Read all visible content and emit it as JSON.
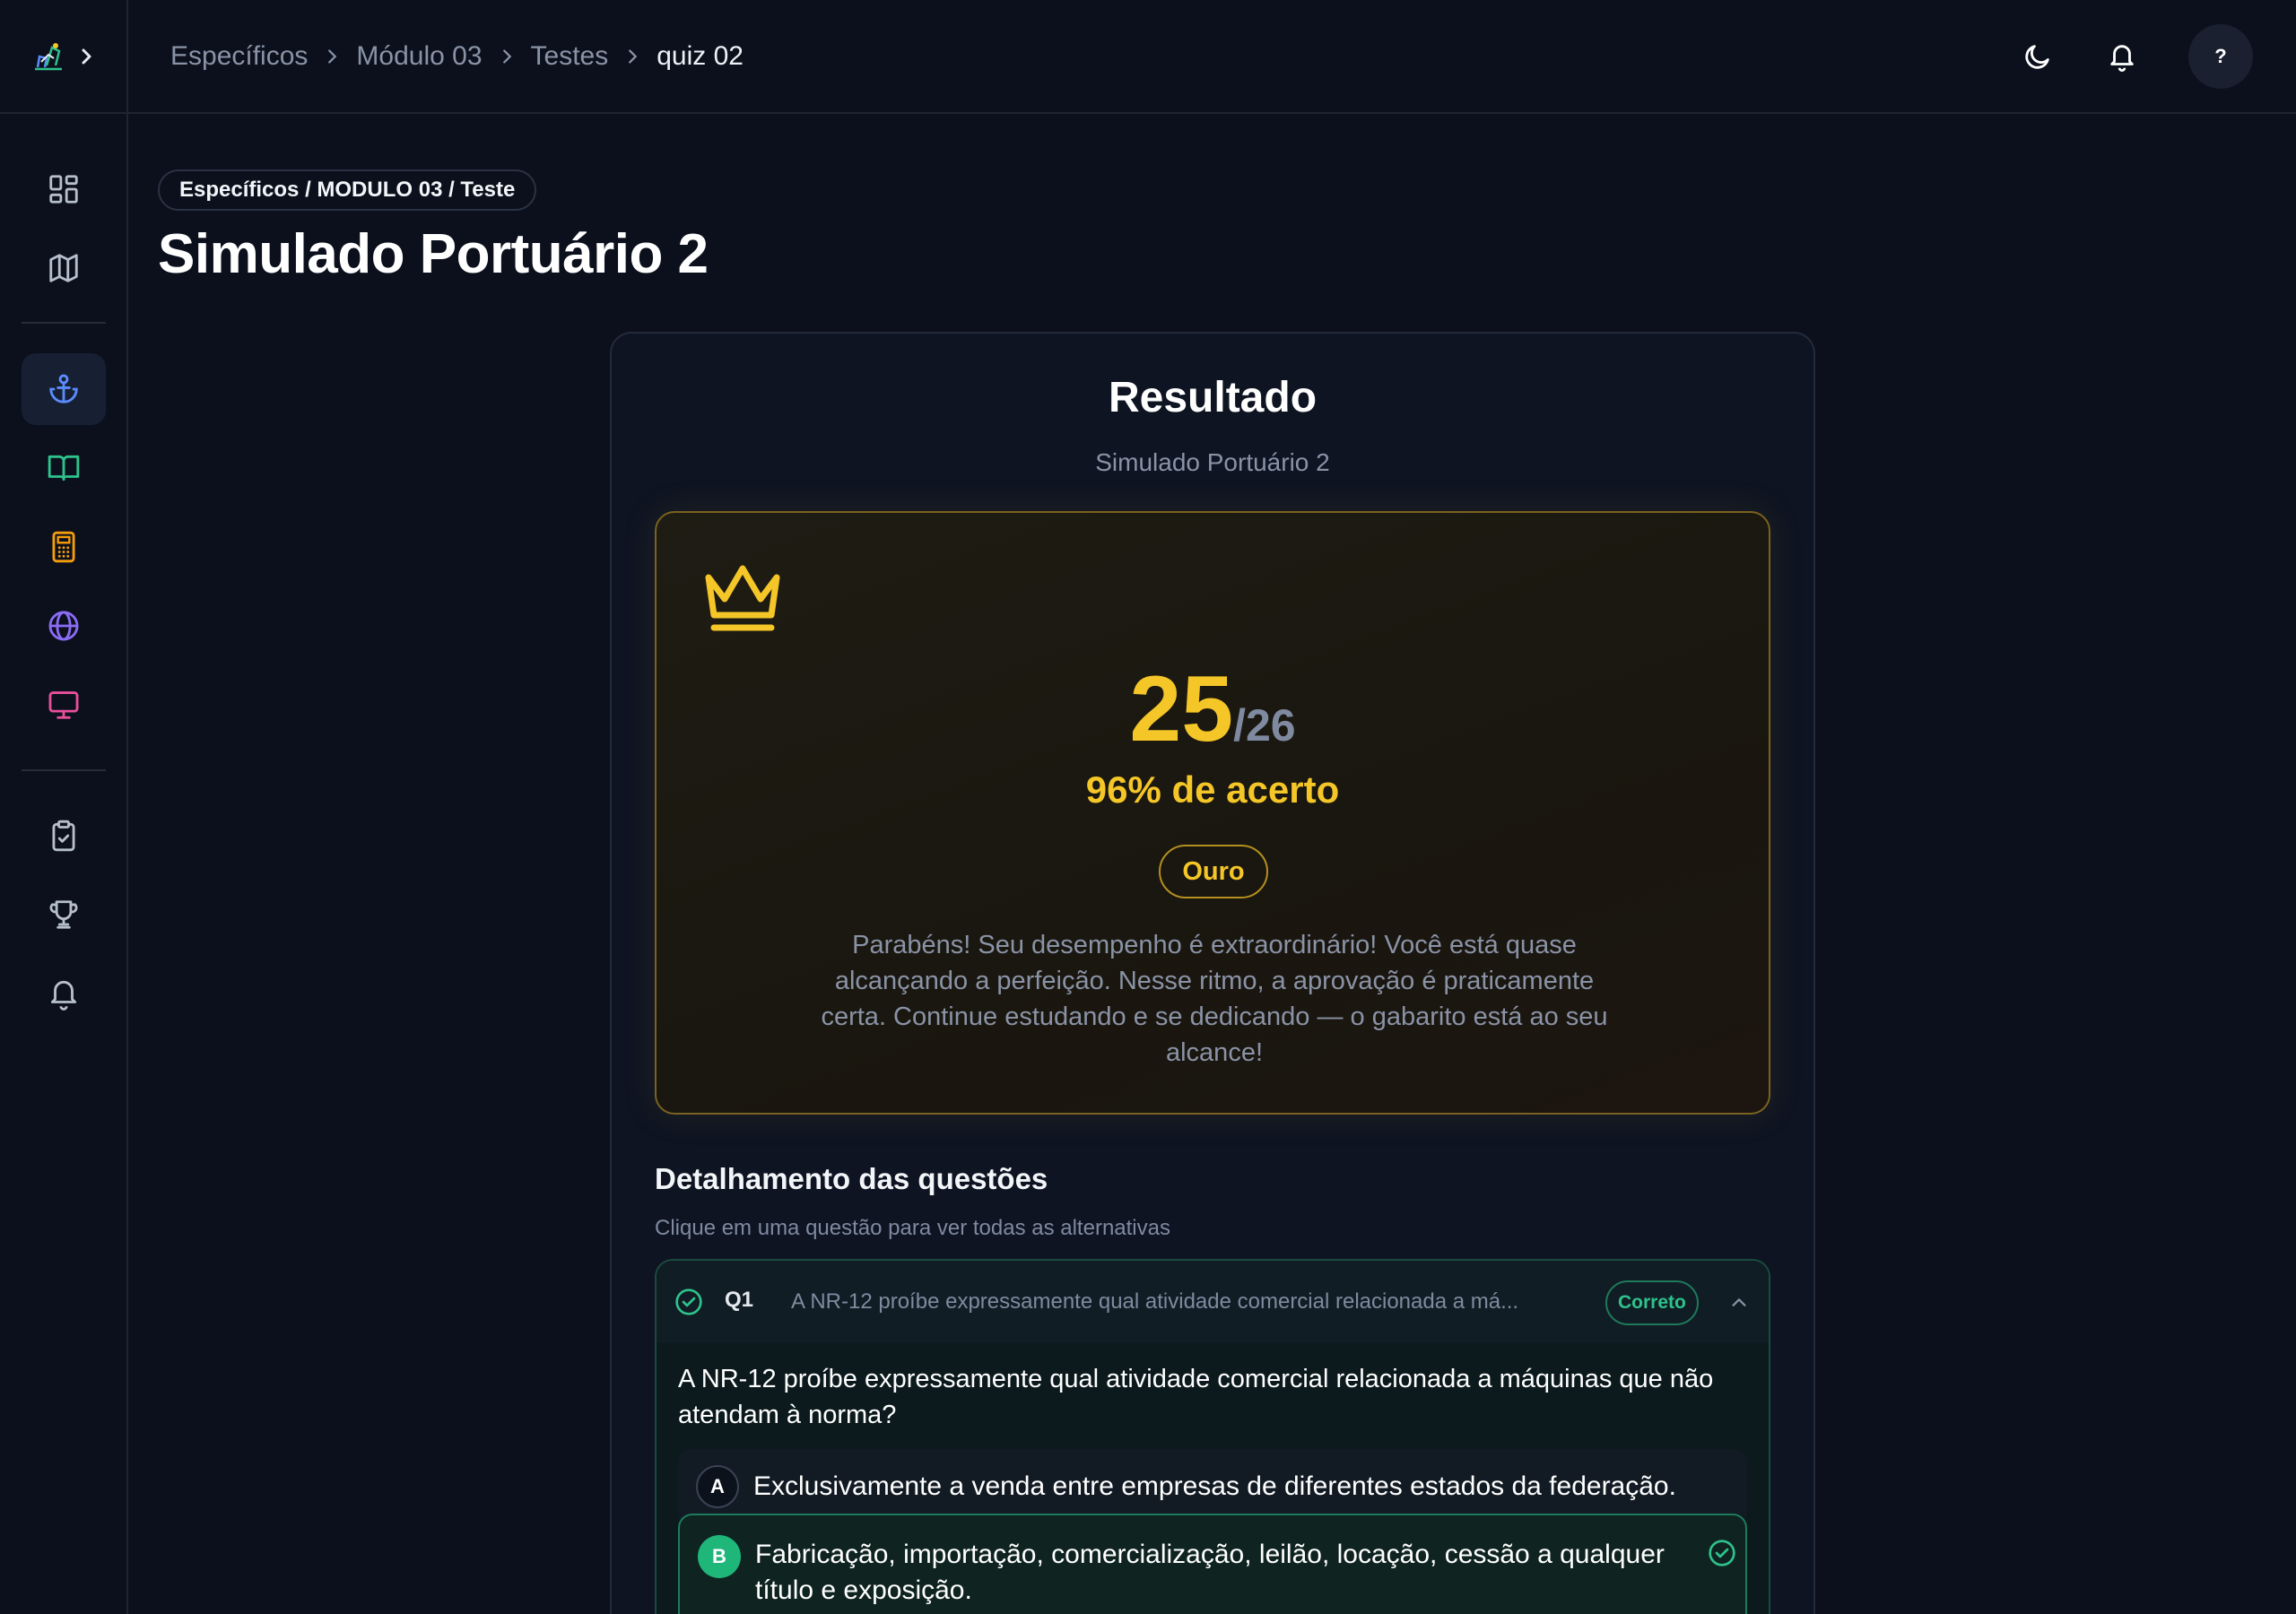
{
  "breadcrumb": {
    "items": [
      "Específicos",
      "Módulo 03",
      "Testes"
    ],
    "current": "quiz 02"
  },
  "header": {
    "help_label": "?"
  },
  "icons": {
    "theme": "moon-icon",
    "notifications": "bell-icon",
    "sidebar": [
      "dashboard-icon",
      "map-icon",
      "anchor-icon",
      "book-open-icon",
      "calculator-icon",
      "globe-icon",
      "monitor-icon",
      "clipboard-check-icon",
      "trophy-icon",
      "bell-icon"
    ]
  },
  "colors": {
    "accent_blue": "#5b8cff",
    "green": "#2ec28c",
    "orange": "#f59e0b",
    "purple": "#8b6cf6",
    "pink": "#e94f9b",
    "gold": "#f5c628"
  },
  "page": {
    "tag": "Específicos / MODULO 03 / Teste",
    "title": "Simulado Portuário 2"
  },
  "result": {
    "title": "Resultado",
    "subtitle": "Simulado Portuário 2",
    "score": "25",
    "total": "/26",
    "percent_text": "96% de acerto",
    "tier": "Ouro",
    "message": "Parabéns! Seu desempenho é extraordinário! Você está quase alcançando a perfeição. Nesse ritmo, a aprovação é praticamente certa. Continue estudando e se dedicando — o gabarito está ao seu alcance!"
  },
  "details": {
    "title": "Detalhamento das questões",
    "hint": "Clique em uma questão para ver todas as alternativas",
    "questions": [
      {
        "number": "Q1",
        "preview": "A NR-12 proíbe expressamente qual atividade comercial relacionada a má...",
        "status": "Correto",
        "text": "A NR-12 proíbe expressamente qual atividade comercial relacionada a máquinas que não atendam à norma?",
        "options": [
          {
            "letter": "A",
            "text": "Exclusivamente a venda entre empresas de diferentes estados da federação."
          },
          {
            "letter": "B",
            "text": "Fabricação, importação, comercialização, leilão, locação, cessão a qualquer título e exposição."
          }
        ]
      }
    ]
  }
}
